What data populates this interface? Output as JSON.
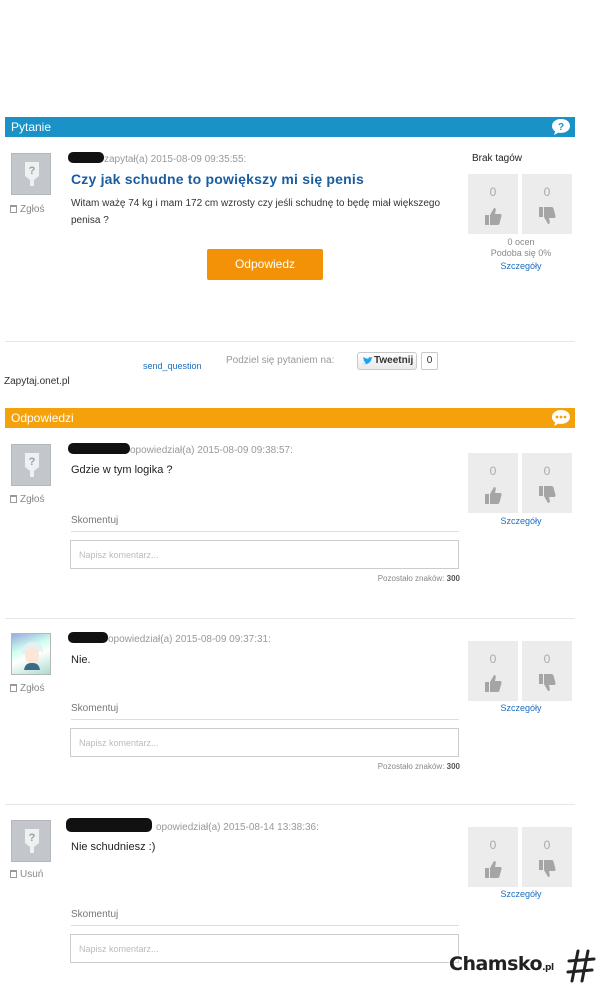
{
  "question_section": {
    "header": "Pytanie",
    "asked_meta": "zapytał(a) 2015-08-09 09:35:55:",
    "title": "Czy jak schudne to powiększy mi się penis",
    "body": "Witam ważę 74 kg i mam 172 cm wzrosty czy jeśli schudnę to będę miał większego penisa ?",
    "report_label": "Zgłoś",
    "answer_button": "Odpowiedz",
    "tags_label": "Brak tagów",
    "votes": {
      "up": "0",
      "down": "0"
    },
    "rating_count": "0 ocen",
    "rating_percent": "Podoba się 0%",
    "details_link": "Szczegóły"
  },
  "share": {
    "send_question": "send_question",
    "label": "Podziel się pytaniem na:",
    "tweet_label": "Tweetnij",
    "tweet_count": "0"
  },
  "source": "Zapytaj.onet.pl",
  "answers_section": {
    "header": "Odpowiedzi",
    "answers": [
      {
        "meta": "opowiedział(a) 2015-08-09 09:38:57:",
        "text": "Gdzie w tym logika ?",
        "report_label": "Zgłoś",
        "votes": {
          "up": "0",
          "down": "0"
        },
        "details_link": "Szczegóły",
        "comment_label": "Skomentuj",
        "comment_placeholder": "Napisz komentarz...",
        "chars_label": "Pozostało znaków:",
        "chars_count": "300"
      },
      {
        "meta": "opowiedział(a) 2015-08-09 09:37:31:",
        "text": "Nie.",
        "report_label": "Zgłoś",
        "votes": {
          "up": "0",
          "down": "0"
        },
        "details_link": "Szczegóły",
        "comment_label": "Skomentuj",
        "comment_placeholder": "Napisz komentarz...",
        "chars_label": "Pozostało znaków:",
        "chars_count": "300"
      },
      {
        "meta": "opowiedział(a) 2015-08-14 13:38:36:",
        "text": "Nie schudniesz :)",
        "report_label": "Usuń",
        "votes": {
          "up": "0",
          "down": "0"
        },
        "details_link": "Szczegóły",
        "comment_label": "Skomentuj",
        "comment_placeholder": "Napisz komentarz..."
      }
    ]
  },
  "watermark": {
    "brand": "Chamsko",
    "suffix": ".pl"
  },
  "colors": {
    "question_bar": "#1a92c7",
    "answers_bar": "#f5a10c",
    "button": "#f39207",
    "title": "#1a5ea0",
    "link": "#1a6ec0"
  },
  "icons": [
    "question-bubble-icon",
    "chat-bubble-icon",
    "thumb-up-icon",
    "thumb-down-icon",
    "trash-icon",
    "twitter-bird-icon",
    "avatar-placeholder-icon"
  ]
}
